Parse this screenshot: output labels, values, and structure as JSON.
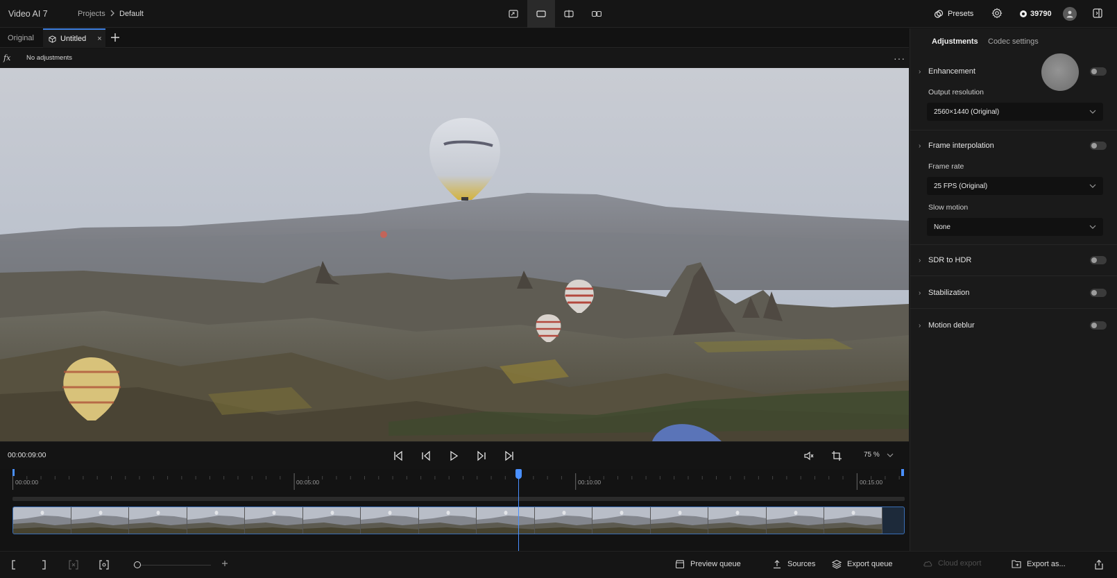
{
  "app": {
    "title": "Video AI 7"
  },
  "breadcrumb": {
    "projects": "Projects",
    "separator": ">",
    "current": "Default"
  },
  "view_modes": [
    "fit-icon",
    "single-view-icon",
    "split-view-icon",
    "side-by-side-icon"
  ],
  "header": {
    "presets_label": "Presets",
    "credits": "39790"
  },
  "tabs": {
    "original": "Original",
    "untitled": "Untitled",
    "close": "×"
  },
  "adjustments_bar": {
    "fx": "fx",
    "status": "No adjustments",
    "more": "···"
  },
  "transport": {
    "timecode": "00:00:09:00",
    "zoom": "75 %"
  },
  "timeline": {
    "ticks": [
      "00:00:00",
      "00:05:00",
      "00:10:00",
      "00:15:00"
    ],
    "frames": 15,
    "playhead_time": "00:00:09:00"
  },
  "bottom": {
    "preview_queue": "Preview queue",
    "sources": "Sources",
    "export_queue": "Export queue",
    "cloud_export": "Cloud export",
    "export_as": "Export as..."
  },
  "right_panel": {
    "tabs": {
      "adjustments": "Adjustments",
      "codec": "Codec settings"
    },
    "enhancement": {
      "label": "Enhancement",
      "enabled": false
    },
    "output_resolution": {
      "label": "Output resolution",
      "value": "2560×1440 (Original)"
    },
    "frame_interpolation": {
      "label": "Frame interpolation",
      "enabled": false
    },
    "frame_rate": {
      "label": "Frame rate",
      "value": "25 FPS (Original)"
    },
    "slow_motion": {
      "label": "Slow motion",
      "value": "None"
    },
    "sdr_to_hdr": {
      "label": "SDR to HDR",
      "enabled": false
    },
    "stabilization": {
      "label": "Stabilization",
      "enabled": false
    },
    "motion_deblur": {
      "label": "Motion deblur",
      "enabled": false
    }
  },
  "colors": {
    "accent": "#4a90ff",
    "background": "#141414",
    "panel": "#1a1a1a"
  }
}
